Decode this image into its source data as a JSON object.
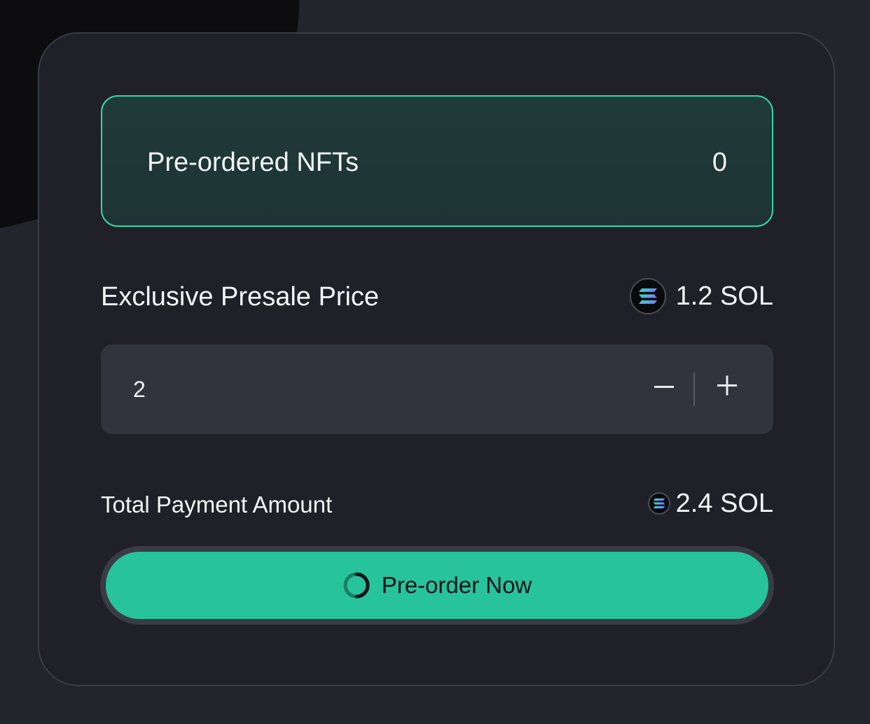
{
  "preordered": {
    "label": "Pre-ordered NFTs",
    "count": "0"
  },
  "price": {
    "label": "Exclusive Presale Price",
    "value": "1.2 SOL",
    "icon": "solana-icon"
  },
  "quantity": {
    "value": "2",
    "decrement_icon": "minus-icon",
    "increment_icon": "plus-icon"
  },
  "total": {
    "label": "Total Payment Amount",
    "value": "2.4 SOL",
    "icon": "solana-icon"
  },
  "action": {
    "label": "Pre-order Now",
    "icon": "loading-spinner-icon"
  },
  "colors": {
    "accent": "#27c39c",
    "accent_border": "#34d7a8",
    "card_background": "#1f2028",
    "page_background": "#23252d"
  }
}
